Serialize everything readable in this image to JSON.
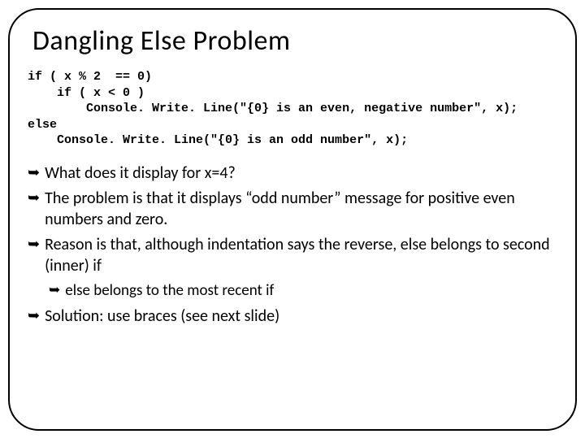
{
  "title": "Dangling Else Problem",
  "code": {
    "l1": "if ( x % 2  == 0)",
    "l2": "    if ( x < 0 )",
    "l3": "        Console. Write. Line(\"{0} is an even, negative number\", x);",
    "l4": "else",
    "l5": "    Console. Write. Line(\"{0} is an odd number\", x);"
  },
  "bullets": {
    "b1": "What does it display for x=4?",
    "b2": "The problem is that it displays “odd number” message for positive even numbers and zero.",
    "b3": "Reason is that, although indentation says the reverse, else belongs to second (inner) if",
    "b3a": "else belongs to the most recent if",
    "b4": "Solution: use braces (see next slide)"
  },
  "glyph": "➥"
}
